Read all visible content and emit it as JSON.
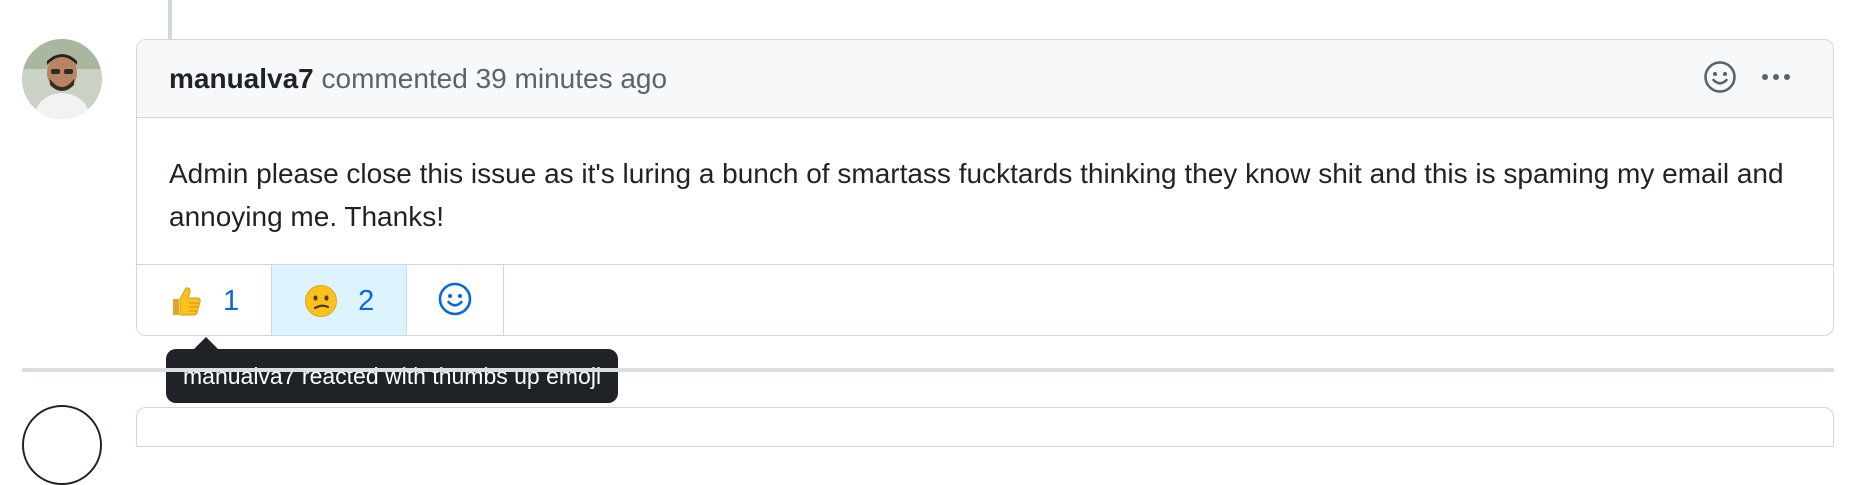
{
  "comment": {
    "author": "manualva7",
    "action": "commented",
    "timestamp": "39 minutes ago",
    "body": "Admin please close this issue as it's luring a bunch of smartass fucktards thinking they know shit and this is spaming my email and annoying me. Thanks!",
    "header_icons": [
      "smiley-icon",
      "kebab-menu-icon"
    ]
  },
  "reactions": [
    {
      "emoji": "thumbs-up",
      "count": "1",
      "active": false
    },
    {
      "emoji": "confused-face",
      "count": "2",
      "active": true
    }
  ],
  "add_reaction_icon": "smiley-icon",
  "tooltip": {
    "text": "manualva7 reacted with thumbs up emoji"
  },
  "colors": {
    "link_blue": "#0969da",
    "active_reaction_bg": "#ddf4ff",
    "border": "#d0d7de",
    "header_bg": "#f6f8fa",
    "tooltip_bg": "#1f2328"
  }
}
